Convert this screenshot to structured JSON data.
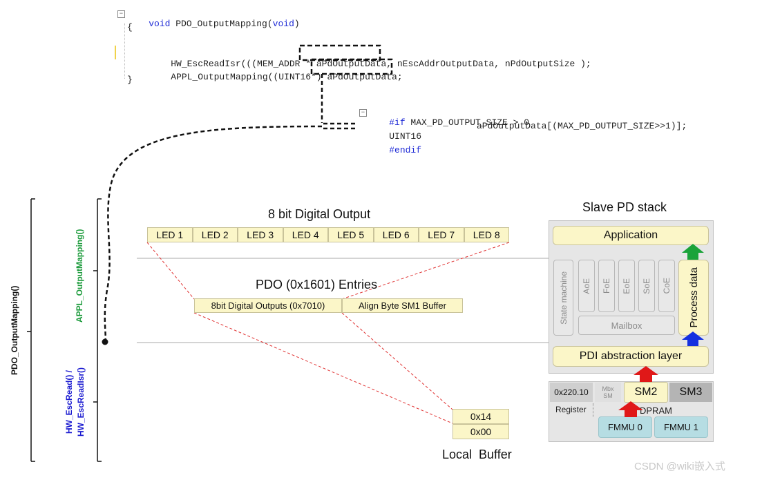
{
  "code_top": {
    "line1_kw": "void",
    "line1_rest": " PDO_OutputMapping(",
    "line1_arg": "void",
    "line1_end": ")",
    "brace_open": "{",
    "line3": "HW_EscReadIsr(((MEM_ADDR * ",
    "line3_var": "aPdOutputData",
    "line3_end": ", nEscAddrOutputData, nPdOutputSize );",
    "line4": "APPL_OutputMapping((UINT16*) ",
    "line4_var": "aPdOutputData",
    "line4_end": ";",
    "brace_close": "}"
  },
  "code_def": {
    "line1_pp": "#if",
    "line1_rest": " MAX_PD_OUTPUT_SIZE > 0",
    "line2_type": "UINT16",
    "line2_rest": "aPdOutputData[(MAX_PD_OUTPUT_SIZE>>1)];",
    "line3_pp": "#endif"
  },
  "left_labels": {
    "pdo_output_mapping": "PDO_OutputMapping()",
    "appl_output_mapping": "APPL_OutputMapping()",
    "hw_esc_read": "HW_EscRead() /\nHW_EscReadIsr()"
  },
  "digital_output": {
    "title": "8 bit Digital Output",
    "leds": [
      "LED 1",
      "LED 2",
      "LED 3",
      "LED 4",
      "LED 5",
      "LED 6",
      "LED 7",
      "LED 8"
    ]
  },
  "pdo_entries": {
    "title": "PDO (0x1601) Entries",
    "entry1": "8bit Digital Outputs (0x7010)",
    "entry2": "Align Byte SM1 Buffer"
  },
  "local_buffer": {
    "title": "Local  Buffer",
    "values": [
      "0x14",
      "0x00"
    ]
  },
  "stack": {
    "title": "Slave PD stack",
    "application": "Application",
    "state_machine": "State machine",
    "aoe": "AoE",
    "foe": "FoE",
    "eoe": "EoE",
    "soe": "SoE",
    "coe": "CoE",
    "mailbox": "Mailbox",
    "process_data": "Process data",
    "pdi": "PDI abstraction layer",
    "reg_addr": "0x220.10",
    "register": "Register",
    "mbx_sm": "Mbx SM",
    "sm2": "SM2",
    "sm3": "SM3",
    "dpram": "DPRAM",
    "fmmu0": "FMMU 0",
    "fmmu1": "FMMU 1"
  },
  "watermark": "CSDN @wiki嵌入式",
  "colors": {
    "cell_fill": "#fbf6c8",
    "arrow_green": "#1aa33a",
    "arrow_blue": "#1430e0",
    "arrow_red": "#e01818",
    "label_green": "#1a9a3a",
    "label_blue": "#1a1ad0",
    "dashed_red": "#e03030"
  }
}
